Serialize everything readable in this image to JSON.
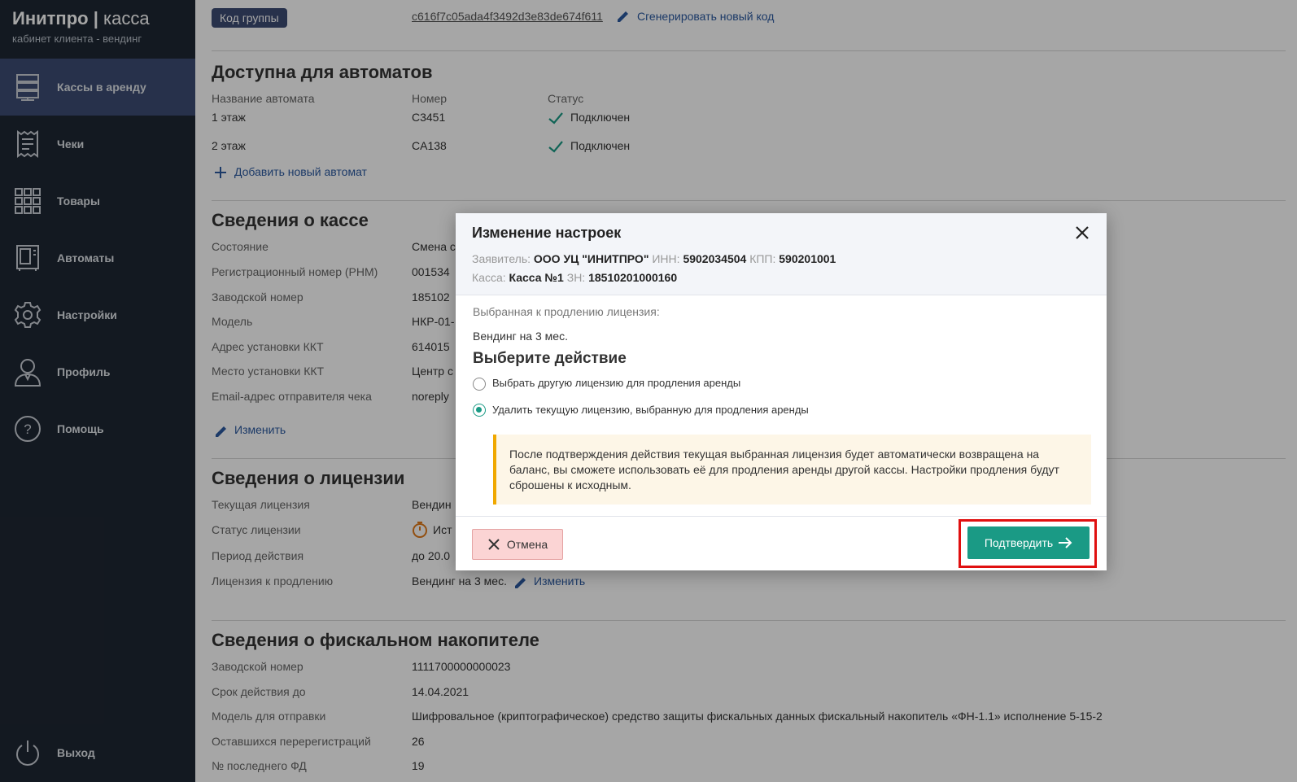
{
  "brand": {
    "name": "Инитпро",
    "product": "касса",
    "subtitle": "кабинет клиента - вендинг"
  },
  "sidebar": {
    "items": [
      {
        "label": "Кассы в аренду",
        "icon": "server-icon",
        "active": true
      },
      {
        "label": "Чеки",
        "icon": "receipt-icon"
      },
      {
        "label": "Товары",
        "icon": "grid-icon"
      },
      {
        "label": "Автоматы",
        "icon": "vending-machine-icon"
      },
      {
        "label": "Настройки",
        "icon": "gear-icon"
      },
      {
        "label": "Профиль",
        "icon": "user-icon"
      },
      {
        "label": "Помощь",
        "icon": "help-icon"
      }
    ],
    "logout": {
      "label": "Выход",
      "icon": "power-icon"
    }
  },
  "group": {
    "badge": "Код группы",
    "code": "c616f7c05ada4f3492d3e83de674f611",
    "regen_link": "Сгенерировать новый код"
  },
  "machines": {
    "title": "Доступна для автоматов",
    "headers": [
      "Название автомата",
      "Номер",
      "Статус"
    ],
    "rows": [
      {
        "name": "1 этаж",
        "number": "C3451",
        "status": "Подключен"
      },
      {
        "name": "2 этаж",
        "number": "CA138",
        "status": "Подключен"
      }
    ],
    "add_link": "Добавить новый автомат"
  },
  "kassa": {
    "title": "Сведения о кассе",
    "rows": [
      {
        "label": "Состояние",
        "value": "Смена с"
      },
      {
        "label": "Регистрационный номер (РНМ)",
        "value": "001534"
      },
      {
        "label": "Заводской номер",
        "value": "185102"
      },
      {
        "label": "Модель",
        "value": "НКР-01-"
      },
      {
        "label": "Адрес установки ККТ",
        "value": "614015"
      },
      {
        "label": "Место установки ККТ",
        "value": "Центр с"
      },
      {
        "label": "Email-адрес отправителя чека",
        "value": "noreply"
      }
    ],
    "edit_link": "Изменить"
  },
  "license": {
    "title": "Сведения о лицензии",
    "rows": [
      {
        "label": "Текущая лицензия",
        "value": "Вендин"
      },
      {
        "label": "Статус лицензии",
        "value": "Ист"
      },
      {
        "label": "Период действия",
        "value": "до 20.0"
      },
      {
        "label": "Лицензия к продлению",
        "value": "Вендинг на 3 мес."
      }
    ],
    "edit_link": "Изменить"
  },
  "fn": {
    "title": "Сведения о фискальном накопителе",
    "rows": [
      {
        "label": "Заводской номер",
        "value": "1111700000000023"
      },
      {
        "label": "Срок действия до",
        "value": "14.04.2021"
      },
      {
        "label": "Модель для отправки",
        "value": "Шифровальное (криптографическое) средство защиты фискальных данных фискальный накопитель «ФН-1.1» исполнение 5-15-2"
      },
      {
        "label": "Оставшихся перерегистраций",
        "value": "26"
      },
      {
        "label": "№ последнего ФД",
        "value": "19"
      }
    ]
  },
  "modal": {
    "title": "Изменение настроек",
    "applicant_label": "Заявитель:",
    "applicant": "ООО УЦ \"ИНИТПРО\"",
    "inn_label": "ИНН:",
    "inn": "5902034504",
    "kpp_label": "КПП:",
    "kpp": "590201001",
    "kassa_label": "Касса:",
    "kassa": "Касса №1",
    "zn_label": "ЗН:",
    "zn": "18510201000160",
    "selected_label": "Выбранная к продлению лицензия:",
    "selected_value": "Вендинг на 3 мес.",
    "action_title": "Выберите действие",
    "options": [
      {
        "label": "Выбрать другую лицензию для продления аренды",
        "checked": false
      },
      {
        "label": "Удалить текущую лицензию, выбранную для продления аренды",
        "checked": true
      }
    ],
    "warning": "После подтверждения действия текущая выбранная лицензия будет автоматически возвращена на баланс, вы сможете использовать её для продления аренды другой кассы. Настройки продления будут сброшены к исходным.",
    "cancel": "Отмена",
    "confirm": "Подтвердить"
  },
  "colors": {
    "sidebar": "#1e2733",
    "active_nav": "#3d4c74",
    "accent": "#1a9a85",
    "link": "#2c5aa0",
    "warning": "#f0a800",
    "highlight": "#e01010"
  }
}
